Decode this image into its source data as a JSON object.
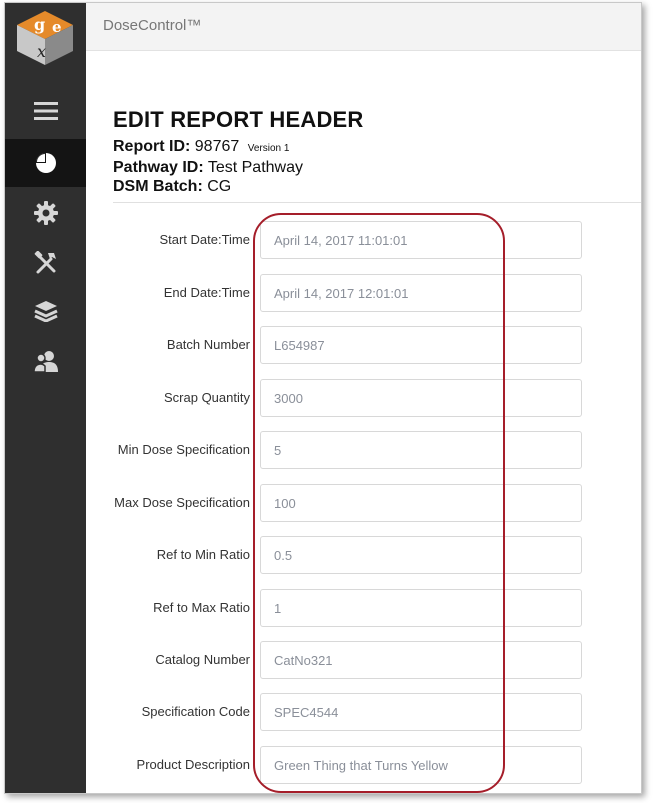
{
  "app": {
    "title": "DoseControl™",
    "logo_letters": [
      "g",
      "e",
      "x"
    ]
  },
  "sidebar": {
    "items": [
      {
        "icon": "menu-icon"
      },
      {
        "icon": "pie-chart-icon",
        "active": true
      },
      {
        "icon": "gear-icon"
      },
      {
        "icon": "tools-icon"
      },
      {
        "icon": "layers-icon"
      },
      {
        "icon": "users-icon"
      }
    ]
  },
  "report": {
    "title": "EDIT REPORT HEADER",
    "report_id_label": "Report ID:",
    "report_id": "98767",
    "version": "Version 1",
    "pathway_label": "Pathway ID:",
    "pathway": "Test Pathway",
    "dsm_label": "DSM Batch:",
    "dsm": "CG"
  },
  "fields": [
    {
      "label": "Start Date:Time",
      "value": "April 14, 2017 11:01:01"
    },
    {
      "label": "End Date:Time",
      "value": "April 14, 2017 12:01:01"
    },
    {
      "label": "Batch Number",
      "value": "L654987"
    },
    {
      "label": "Scrap Quantity",
      "value": "3000"
    },
    {
      "label": "Min Dose Specification",
      "value": "5"
    },
    {
      "label": "Max Dose Specification",
      "value": "100"
    },
    {
      "label": "Ref to Min Ratio",
      "value": "0.5"
    },
    {
      "label": "Ref to Max Ratio",
      "value": "1"
    },
    {
      "label": "Catalog Number",
      "value": "CatNo321"
    },
    {
      "label": "Specification Code",
      "value": "SPEC4544"
    },
    {
      "label": "Product Description",
      "value": "Green Thing that Turns Yellow"
    }
  ],
  "colors": {
    "sidebar": "#2f2f2f",
    "active_nav": "#141414",
    "highlight": "#a51e2a"
  }
}
